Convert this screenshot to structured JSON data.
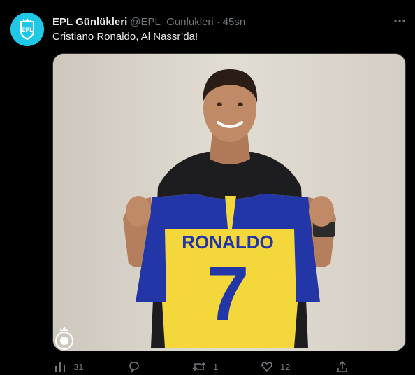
{
  "tweet": {
    "author_name": "EPL Günlükleri",
    "handle": "@EPL_Gunlukleri",
    "separator": "·",
    "time": "45sn",
    "text": "Cristiano Ronaldo, Al Nassr’da!",
    "avatar_text": "EPL",
    "media": {
      "jersey_name": "RONALDO",
      "jersey_number": "7"
    },
    "stats": {
      "views": "31",
      "replies": "",
      "retweets": "1",
      "likes": "12"
    }
  },
  "colors": {
    "avatar_bg": "#1ec8e6",
    "jersey_yellow": "#f4d73a",
    "jersey_blue": "#2336a8",
    "text_secondary": "#71767b"
  },
  "icons": [
    "more-icon",
    "views-icon",
    "reply-icon",
    "retweet-icon",
    "like-icon",
    "share-icon",
    "club-crest-icon"
  ]
}
